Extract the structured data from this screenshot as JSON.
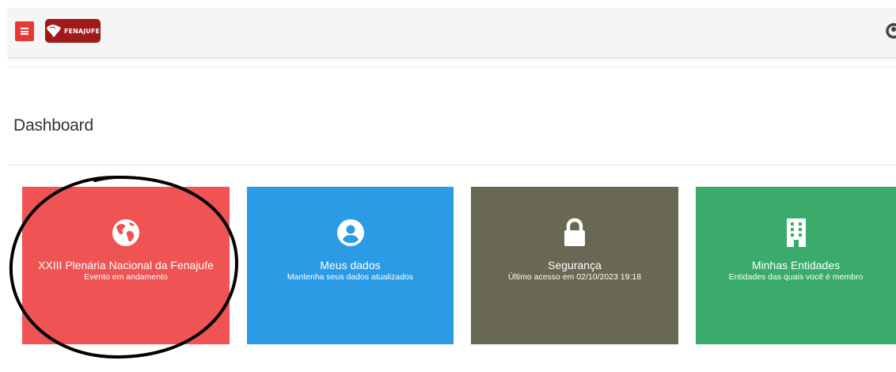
{
  "header": {
    "menu_button_icon": "hamburger-icon",
    "logo_text": "FENAJUFE",
    "logo_icon": "brazil-map-icon",
    "user_icon": "user-icon"
  },
  "page": {
    "title": "Dashboard"
  },
  "cards": [
    {
      "title": "XXIII Plenária Nacional da Fenajufe",
      "subtitle": "Evento em andamento",
      "icon": "globe-icon",
      "color": "#ef5353"
    },
    {
      "title": "Meus dados",
      "subtitle": "Mantenha seus dados atualizados",
      "icon": "user-circle-icon",
      "color": "#2b9be6"
    },
    {
      "title": "Segurança",
      "subtitle": "Último acesso em 02/10/2023 19:18",
      "icon": "lock-icon",
      "color": "#686854"
    },
    {
      "title": "Minhas Entidades",
      "subtitle": "Entidades das quais você é membro",
      "icon": "building-icon",
      "color": "#3aab6b"
    }
  ],
  "colors": {
    "accent_red": "#e53935",
    "logo_bg": "#a1191b",
    "header_bg": "#f5f5f5",
    "annotation": "#000000"
  }
}
